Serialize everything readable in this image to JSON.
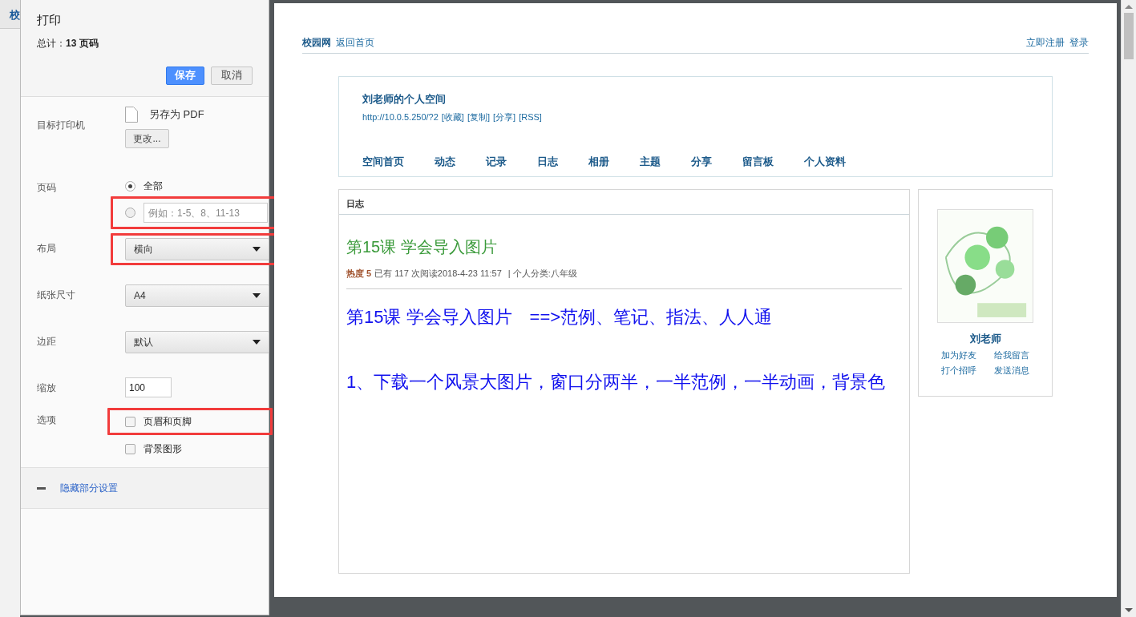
{
  "background_tab": {
    "label": "校"
  },
  "print_panel": {
    "title": "打印",
    "total": "总计：**13 页码**",
    "buttons": [
      {
        "label": "保存",
        "kind": "primary"
      },
      {
        "label": "取消",
        "kind": "secondary"
      }
    ],
    "settings": [
      {
        "kind": "printer",
        "label": "目标打印机",
        "value": "另存为 PDF",
        "button": "更改..."
      },
      {
        "kind": "pages",
        "label": "页码",
        "options": [
          {
            "label": "全部",
            "selected": true,
            "highlighted": false
          },
          {
            "placeholder": "例如：1-5、8、11-13",
            "selected": false,
            "highlighted": true
          }
        ]
      },
      {
        "kind": "select",
        "label": "布局",
        "value": "横向",
        "highlighted": true
      },
      {
        "kind": "select",
        "label": "纸张尺寸",
        "value": "A4",
        "highlighted": false
      },
      {
        "kind": "select",
        "label": "边距",
        "value": "默认",
        "highlighted": false
      },
      {
        "kind": "input",
        "label": "缩放",
        "value": "100"
      },
      {
        "kind": "checks",
        "label": "选项",
        "items": [
          {
            "label": "页眉和页脚",
            "checked": false,
            "highlighted": true
          },
          {
            "label": "背景图形",
            "checked": false,
            "highlighted": false
          }
        ]
      }
    ],
    "more_settings": "隐藏部分设置"
  },
  "preview": {
    "topbar": {
      "site": "校园网",
      "home": "返回首页",
      "right_links": [
        "立即注册",
        "登录"
      ]
    },
    "header": {
      "title": "刘老师的个人空间",
      "url": "http://10.0.5.250/?2",
      "links": [
        "[收藏]",
        "[复制]",
        "[分享]",
        "[RSS]"
      ],
      "nav": [
        "空间首页",
        "动态",
        "记录",
        "日志",
        "相册",
        "主题",
        "分享",
        "留言板",
        "个人资料"
      ]
    },
    "article": {
      "section": "日志",
      "title": "第15课 学会导入图片",
      "heat": "热度 5",
      "meta": "已有 117 次阅读2018-4-23 11:57",
      "category": "| 个人分类:八年级",
      "body": [
        "第15课 学会导入图片　==>范例、笔记、指法、人人通",
        "1、下载一个风景大图片，窗口分两半，一半范例，一半动画，背景色"
      ]
    },
    "profile": {
      "name": "刘老师",
      "links": [
        "加为好友",
        "给我留言",
        "打个招呼",
        "发送消息"
      ]
    }
  }
}
